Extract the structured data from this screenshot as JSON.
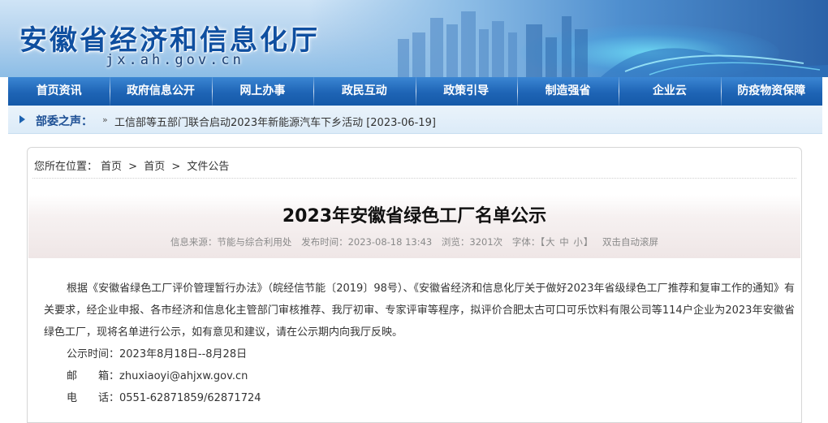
{
  "header": {
    "site_title": "安徽省经济和信息化厅",
    "site_domain": "jx.ah.gov.cn"
  },
  "nav": {
    "items": [
      "首页资讯",
      "政府信息公开",
      "网上办事",
      "政民互动",
      "政策引导",
      "制造强省",
      "企业云",
      "防疫物资保障"
    ]
  },
  "ticker": {
    "label": "部委之声：",
    "arrow": "»",
    "link_text": "工信部等五部门联合启动2023年新能源汽车下乡活动 [2023-06-19]"
  },
  "breadcrumb": {
    "prefix": "您所在位置：",
    "items": [
      "首页",
      "首页",
      "文件公告"
    ],
    "separator": ">"
  },
  "article": {
    "title": "2023年安徽省绿色工厂名单公示",
    "meta": {
      "source": "信息来源：节能与综合利用处",
      "date": "发布时间：2023-08-18 13:43",
      "views": "浏览：3201次",
      "font_label": "字体：【",
      "font_large": "大",
      "font_medium": "中",
      "font_small": "小",
      "font_close": "】",
      "autoscroll": "双击自动滚屏"
    },
    "paragraph": "根据《安徽省绿色工厂评价管理暂行办法》（皖经信节能〔2019〕98号）、《安徽省经济和信息化厅关于做好2023年省级绿色工厂推荐和复审工作的通知》有关要求，经企业申报、各市经济和信息化主管部门审核推荐、我厅初审、专家评审等程序，拟评价合肥太古可口可乐饮料有限公司等114户企业为2023年安徽省绿色工厂，现将名单进行公示，如有意见和建议，请在公示期内向我厅反映。",
    "period": "公示时间：2023年8月18日--8月28日",
    "email_label": "邮　　箱：",
    "email": "zhuxiaoyi@ahjxw.gov.cn",
    "phone_label": "电　　话：",
    "phone": "0551-62871859/62871724"
  },
  "colors": {
    "nav_bg": "#1e64b5",
    "title_blue": "#0f4fa0",
    "ticker_label": "#1d4f94"
  }
}
